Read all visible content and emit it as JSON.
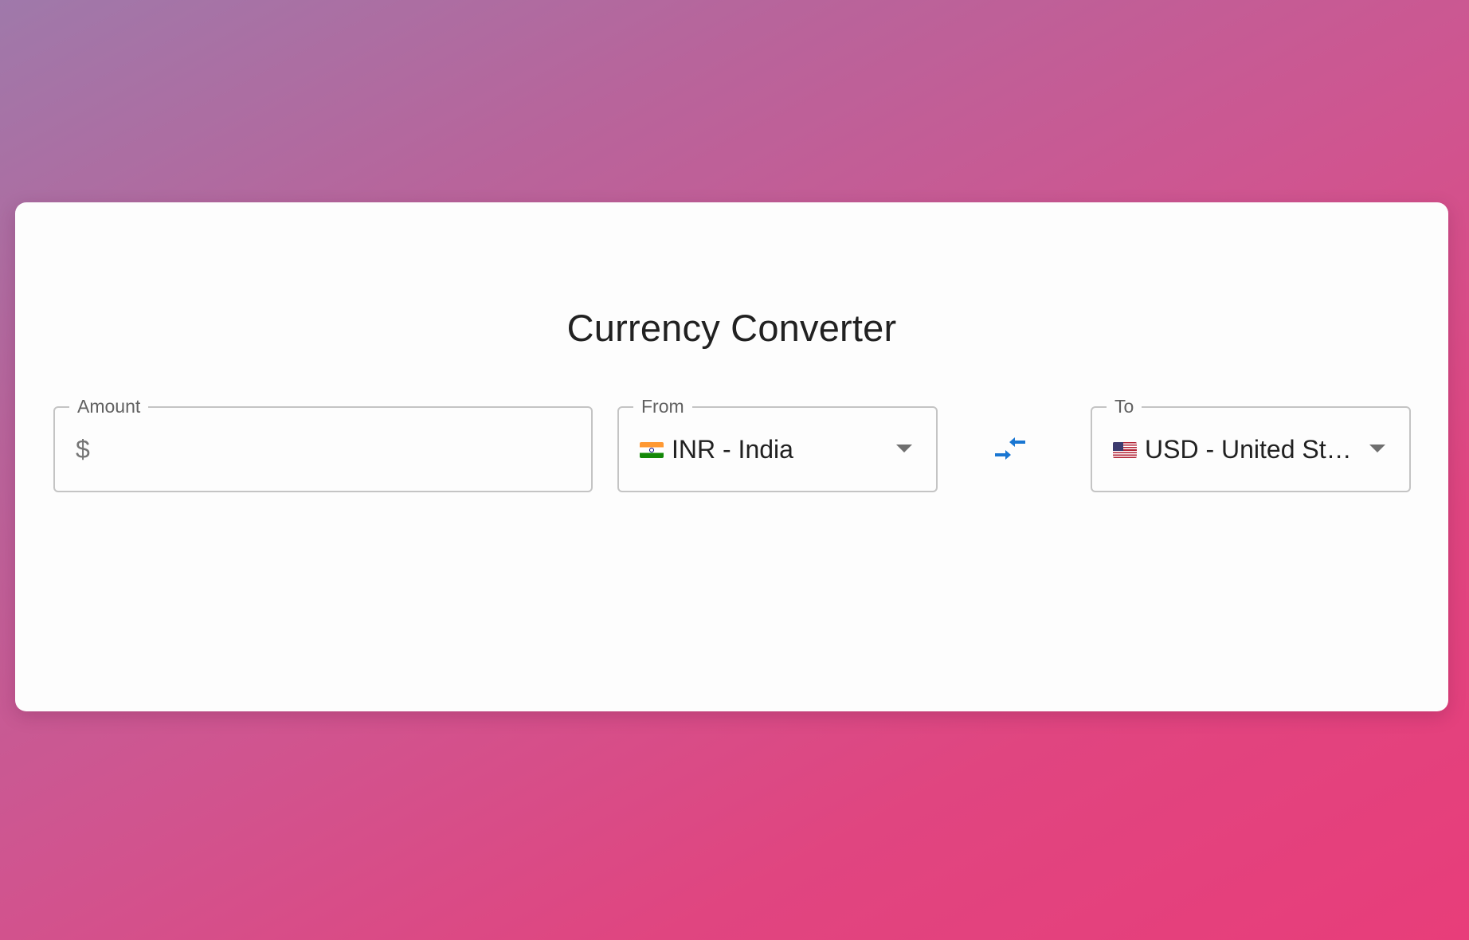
{
  "title": "Currency Converter",
  "amount": {
    "label": "Amount",
    "prefix": "$",
    "value": "",
    "placeholder": ""
  },
  "from": {
    "label": "From",
    "flag_icon": "india-flag-icon",
    "value": "INR - India"
  },
  "to": {
    "label": "To",
    "flag_icon": "us-flag-icon",
    "value": "USD - United St…"
  },
  "swap": {
    "icon": "swap-arrows-icon",
    "color": "#1976d2"
  },
  "colors": {
    "background_gradient_start": "#9f79aa",
    "background_gradient_end": "#e83d7a",
    "card": "#fdfdfd",
    "accent": "#1976d2"
  }
}
